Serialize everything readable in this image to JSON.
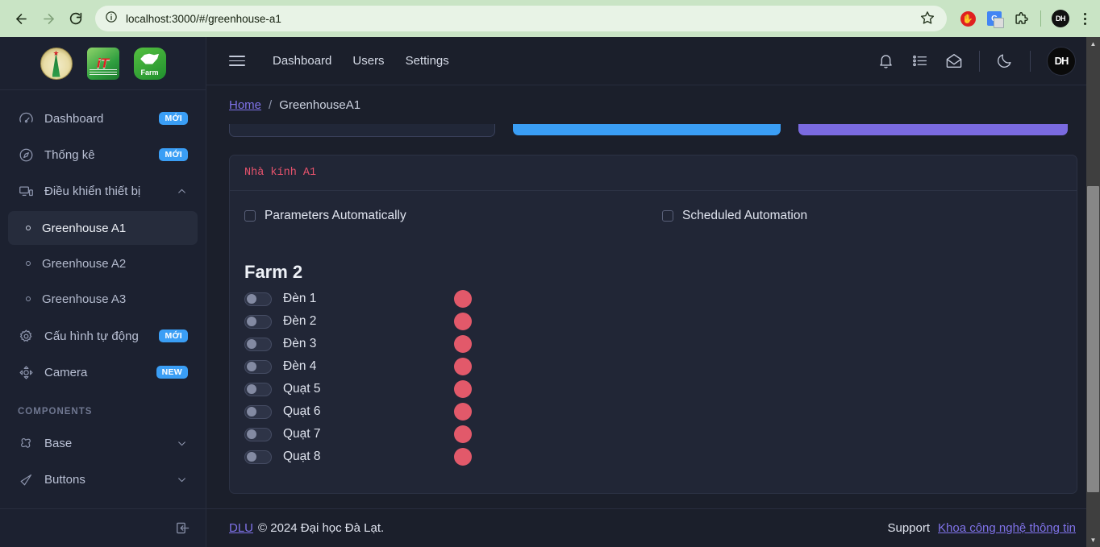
{
  "browser": {
    "url": "localhost:3000/#/greenhouse-a1",
    "back_icon": "back-arrow-icon",
    "forward_icon": "forward-arrow-icon",
    "reload_icon": "reload-icon",
    "site_info_icon": "site-info-icon",
    "star_icon": "bookmark-star-icon",
    "adblock_label": "✋",
    "translate_label": "G",
    "extensions_icon": "extensions-puzzle-icon",
    "profile_label": "DH",
    "menu_icon": "kebab-menu-icon"
  },
  "sidebar": {
    "logos": [
      {
        "name": "university-seal-logo"
      },
      {
        "name": "it-faculty-logo",
        "text": "iT"
      },
      {
        "name": "farm-logo",
        "text": "Farm"
      }
    ],
    "items": [
      {
        "label": "Dashboard",
        "badge": "MỚI",
        "icon": "gauge-icon"
      },
      {
        "label": "Thống kê",
        "badge": "MỚI",
        "icon": "compass-icon"
      },
      {
        "label": "Điều khiển thiết bị",
        "badge": "",
        "icon": "devices-icon",
        "chevron": "chevron-up"
      }
    ],
    "sub_items": [
      {
        "label": "Greenhouse A1",
        "active": true
      },
      {
        "label": "Greenhouse A2",
        "active": false
      },
      {
        "label": "Greenhouse A3",
        "active": false
      }
    ],
    "items2": [
      {
        "label": "Cấu hình tự động",
        "badge": "MỚI",
        "icon": "gear-icon"
      },
      {
        "label": "Camera",
        "badge": "NEW",
        "icon": "camera-move-icon"
      }
    ],
    "section_label": "COMPONENTS",
    "components": [
      {
        "label": "Base",
        "icon": "puzzle-icon",
        "chevron": "chevron-down"
      },
      {
        "label": "Buttons",
        "icon": "cursor-icon",
        "chevron": "chevron-down"
      }
    ],
    "collapse_icon": "collapse-sidebar-icon",
    "badge_color": "#3a9ef5"
  },
  "header": {
    "menu_icon": "hamburger-icon",
    "links": [
      "Dashboard",
      "Users",
      "Settings"
    ],
    "icons": [
      "bell-icon",
      "task-list-icon",
      "envelope-icon",
      "moon-icon"
    ],
    "avatar_label": "DH"
  },
  "breadcrumb": {
    "home": "Home",
    "separator": "/",
    "current": "GreenhouseA1"
  },
  "card": {
    "title": "Nhà kính A1",
    "title_color": "#e8536d",
    "checkboxes": [
      {
        "label": "Parameters Automatically",
        "checked": false
      },
      {
        "label": "Scheduled Automation",
        "checked": false
      }
    ],
    "farm_title": "Farm 2",
    "devices": [
      {
        "name": "Đèn 1",
        "on": false,
        "status_color": "#e2596a"
      },
      {
        "name": "Đèn 2",
        "on": false,
        "status_color": "#e2596a"
      },
      {
        "name": "Đèn 3",
        "on": false,
        "status_color": "#e2596a"
      },
      {
        "name": "Đèn 4",
        "on": false,
        "status_color": "#e2596a"
      },
      {
        "name": "Quạt 5",
        "on": false,
        "status_color": "#e2596a"
      },
      {
        "name": "Quạt 6",
        "on": false,
        "status_color": "#e2596a"
      },
      {
        "name": "Quạt 7",
        "on": false,
        "status_color": "#e2596a"
      },
      {
        "name": "Quạt 8",
        "on": false,
        "status_color": "#e2596a"
      }
    ]
  },
  "footer": {
    "brand_link": "DLU",
    "copyright": "© 2024 Đại học Đà Lạt.",
    "support_label": "Support",
    "support_link": "Khoa công nghệ thông tin"
  }
}
